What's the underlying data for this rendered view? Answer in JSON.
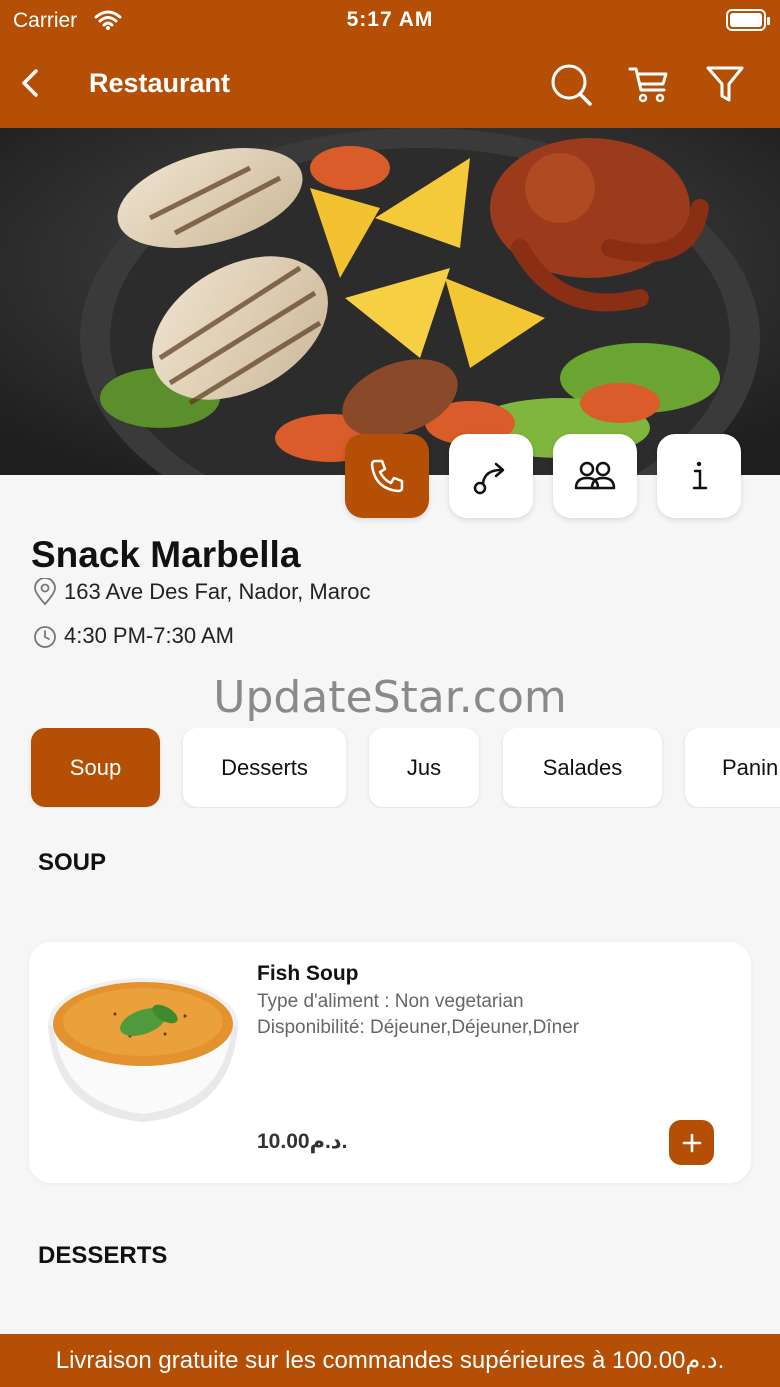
{
  "status_bar": {
    "carrier": "Carrier",
    "time": "5:17 AM"
  },
  "header": {
    "title": "Restaurant"
  },
  "restaurant": {
    "name": "Snack Marbella",
    "address": "163 Ave Des Far, Nador, Maroc",
    "hours": "4:30 PM-7:30 AM"
  },
  "watermark": "UpdateStar.com",
  "categories": [
    {
      "label": "Soup",
      "active": true
    },
    {
      "label": "Desserts",
      "active": false
    },
    {
      "label": "Jus",
      "active": false
    },
    {
      "label": "Salades",
      "active": false
    },
    {
      "label": "Panin",
      "active": false
    }
  ],
  "sections": [
    {
      "title": "SOUP",
      "items": [
        {
          "name": "Fish Soup",
          "food_type": "Type d'aliment : Non vegetarian",
          "availability": "Disponibilité: Déjeuner,Déjeuner,Dîner",
          "price": "10.00د.م."
        }
      ]
    },
    {
      "title": "DESSERTS",
      "items": []
    }
  ],
  "banner": "Livraison gratuite sur les commandes supérieures à 100.00د.م.",
  "colors": {
    "accent": "#b64f06",
    "background": "#f6f6f6"
  }
}
